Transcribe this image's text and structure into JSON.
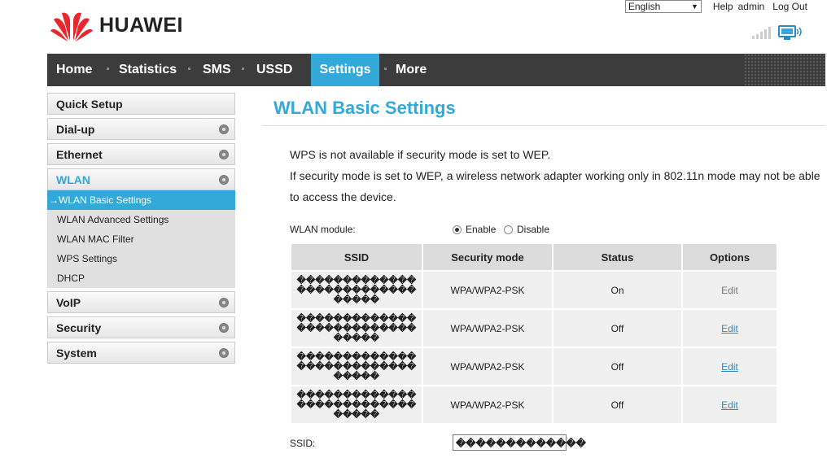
{
  "brand": {
    "name": "HUAWEI"
  },
  "util": {
    "language": "English",
    "help": "Help",
    "user": "admin",
    "logout": "Log Out"
  },
  "nav": {
    "home": "Home",
    "statistics": "Statistics",
    "sms": "SMS",
    "ussd": "USSD",
    "settings": "Settings",
    "more": "More"
  },
  "sidebar": {
    "quick_setup": "Quick Setup",
    "dialup": "Dial-up",
    "ethernet": "Ethernet",
    "wlan": "WLAN",
    "wlan_items": [
      "WLAN Basic Settings",
      "WLAN Advanced Settings",
      "WLAN MAC Filter",
      "WPS Settings",
      "DHCP"
    ],
    "voip": "VoIP",
    "security": "Security",
    "system": "System"
  },
  "main": {
    "title": "WLAN Basic Settings",
    "note1": "WPS is not available if security mode is set to WEP.",
    "note2": "If security mode is set to WEP, a wireless network adapter working only in 802.11n mode may not be able",
    "note3": "to access the device.",
    "module_label": "WLAN module:",
    "enable": "Enable",
    "disable": "Disable",
    "table": {
      "headers": [
        "SSID",
        "Security mode",
        "Status",
        "Options"
      ],
      "rows": [
        {
          "ssid": "�������������������������������",
          "security": "WPA/WPA2-PSK",
          "status": "On",
          "option": "Edit"
        },
        {
          "ssid": "�������������������������������",
          "security": "WPA/WPA2-PSK",
          "status": "Off",
          "option": "Edit"
        },
        {
          "ssid": "�������������������������������",
          "security": "WPA/WPA2-PSK",
          "status": "Off",
          "option": "Edit"
        },
        {
          "ssid": "�������������������������������",
          "security": "WPA/WPA2-PSK",
          "status": "Off",
          "option": "Edit"
        }
      ]
    },
    "ssid_label": "SSID:",
    "ssid_value": "�������������"
  },
  "colors": {
    "accent": "#32a9d8",
    "nav_bg": "#3c3c3c",
    "logo_red": "#e8262b"
  },
  "icons": {
    "signal": "signal-bars-icon",
    "connection": "monitor-connection-icon",
    "arrow": "arrow-right-icon"
  }
}
